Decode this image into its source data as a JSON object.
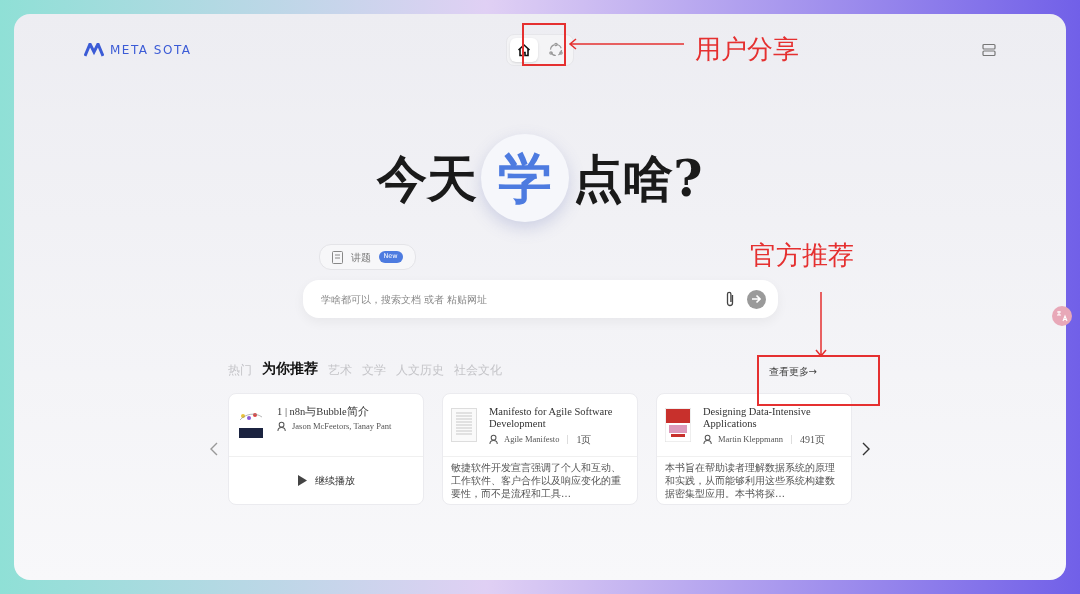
{
  "header": {
    "logo": "META SOTA",
    "nav": [
      {
        "kind": "home",
        "selected": true
      },
      {
        "kind": "share",
        "selected": false
      }
    ]
  },
  "hero": {
    "before": "今天",
    "highlight": "学",
    "after": "点啥?"
  },
  "mode_chip": {
    "label": "讲题",
    "badge": "New"
  },
  "search": {
    "placeholder": "学啥都可以，搜索文档 或者 粘贴网址"
  },
  "categories": [
    {
      "label": "热门",
      "selected": false
    },
    {
      "label": "为你推荐",
      "selected": true
    },
    {
      "label": "艺术",
      "selected": false
    },
    {
      "label": "文学",
      "selected": false
    },
    {
      "label": "人文历史",
      "selected": false
    },
    {
      "label": "社会文化",
      "selected": false
    }
  ],
  "more_link": "查看更多→",
  "cards": [
    {
      "kind": "video",
      "title": "1 | n8n与Bubble简介",
      "author": "Jason McFeetors, Tanay Pant",
      "action": "继续播放"
    },
    {
      "kind": "book",
      "title": "Manifesto for Agile Software Development",
      "author": "Agile Manifesto",
      "pages": "1页",
      "summary": "敏捷软件开发宣言强调了个人和互动、工作软件、客户合作以及响应变化的重要性，而不是流程和工具…"
    },
    {
      "kind": "book",
      "title": "Designing Data-Intensive Applications",
      "author": "Martin Kleppmann",
      "pages": "491页",
      "summary": "本书旨在帮助读者理解数据系统的原理和实践，从而能够利用这些系统构建数据密集型应用。本书将探…"
    }
  ],
  "annotations": [
    {
      "text": "用户分享"
    },
    {
      "text": "官方推荐"
    }
  ]
}
